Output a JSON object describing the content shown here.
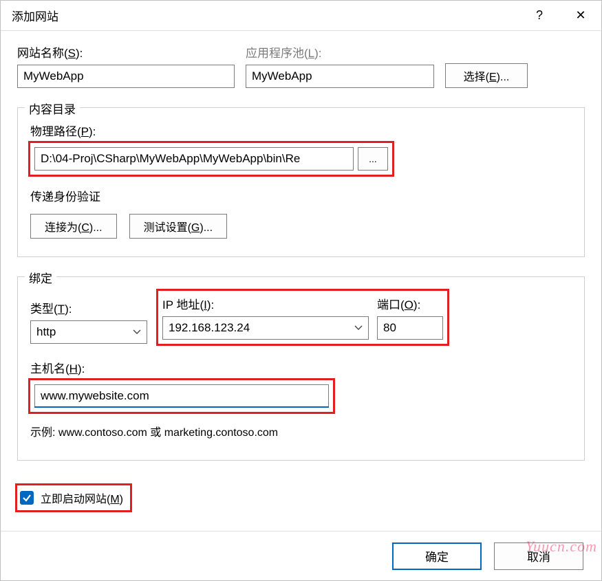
{
  "titlebar": {
    "title": "添加网站",
    "help": "?",
    "close": "✕"
  },
  "site": {
    "name_label": "网站名称(",
    "name_hotkey": "S",
    "name_label_post": "):",
    "name_value": "MyWebApp",
    "apppool_label": "应用程序池(",
    "apppool_hotkey": "L",
    "apppool_label_post": "):",
    "apppool_value": "MyWebApp",
    "select_label_pre": "选择(",
    "select_hotkey": "E",
    "select_label_post": ")..."
  },
  "content": {
    "legend": "内容目录",
    "path_label": "物理路径(",
    "path_hotkey": "P",
    "path_label_post": "):",
    "path_value": "D:\\04-Proj\\CSharp\\MyWebApp\\MyWebApp\\bin\\Re",
    "browse": "...",
    "auth_label": "传递身份验证",
    "connect_label": "连接为(",
    "connect_hotkey": "C",
    "connect_label_post": ")...",
    "test_label": "测试设置(",
    "test_hotkey": "G",
    "test_label_post": ")..."
  },
  "binding": {
    "legend": "绑定",
    "type_label": "类型(",
    "type_hotkey": "T",
    "type_label_post": "):",
    "type_value": "http",
    "ip_label": "IP 地址(",
    "ip_hotkey": "I",
    "ip_label_post": "):",
    "ip_value": "192.168.123.24",
    "port_label": "端口(",
    "port_hotkey": "O",
    "port_label_post": "):",
    "port_value": "80",
    "host_label": "主机名(",
    "host_hotkey": "H",
    "host_label_post": "):",
    "host_value": "www.mywebsite.com",
    "example": "示例: www.contoso.com 或 marketing.contoso.com"
  },
  "start_now": {
    "label": "立即启动网站(",
    "hotkey": "M",
    "label_post": ")",
    "checked": true
  },
  "footer": {
    "ok": "确定",
    "cancel": "取消"
  },
  "watermark": "Yuucn.com"
}
